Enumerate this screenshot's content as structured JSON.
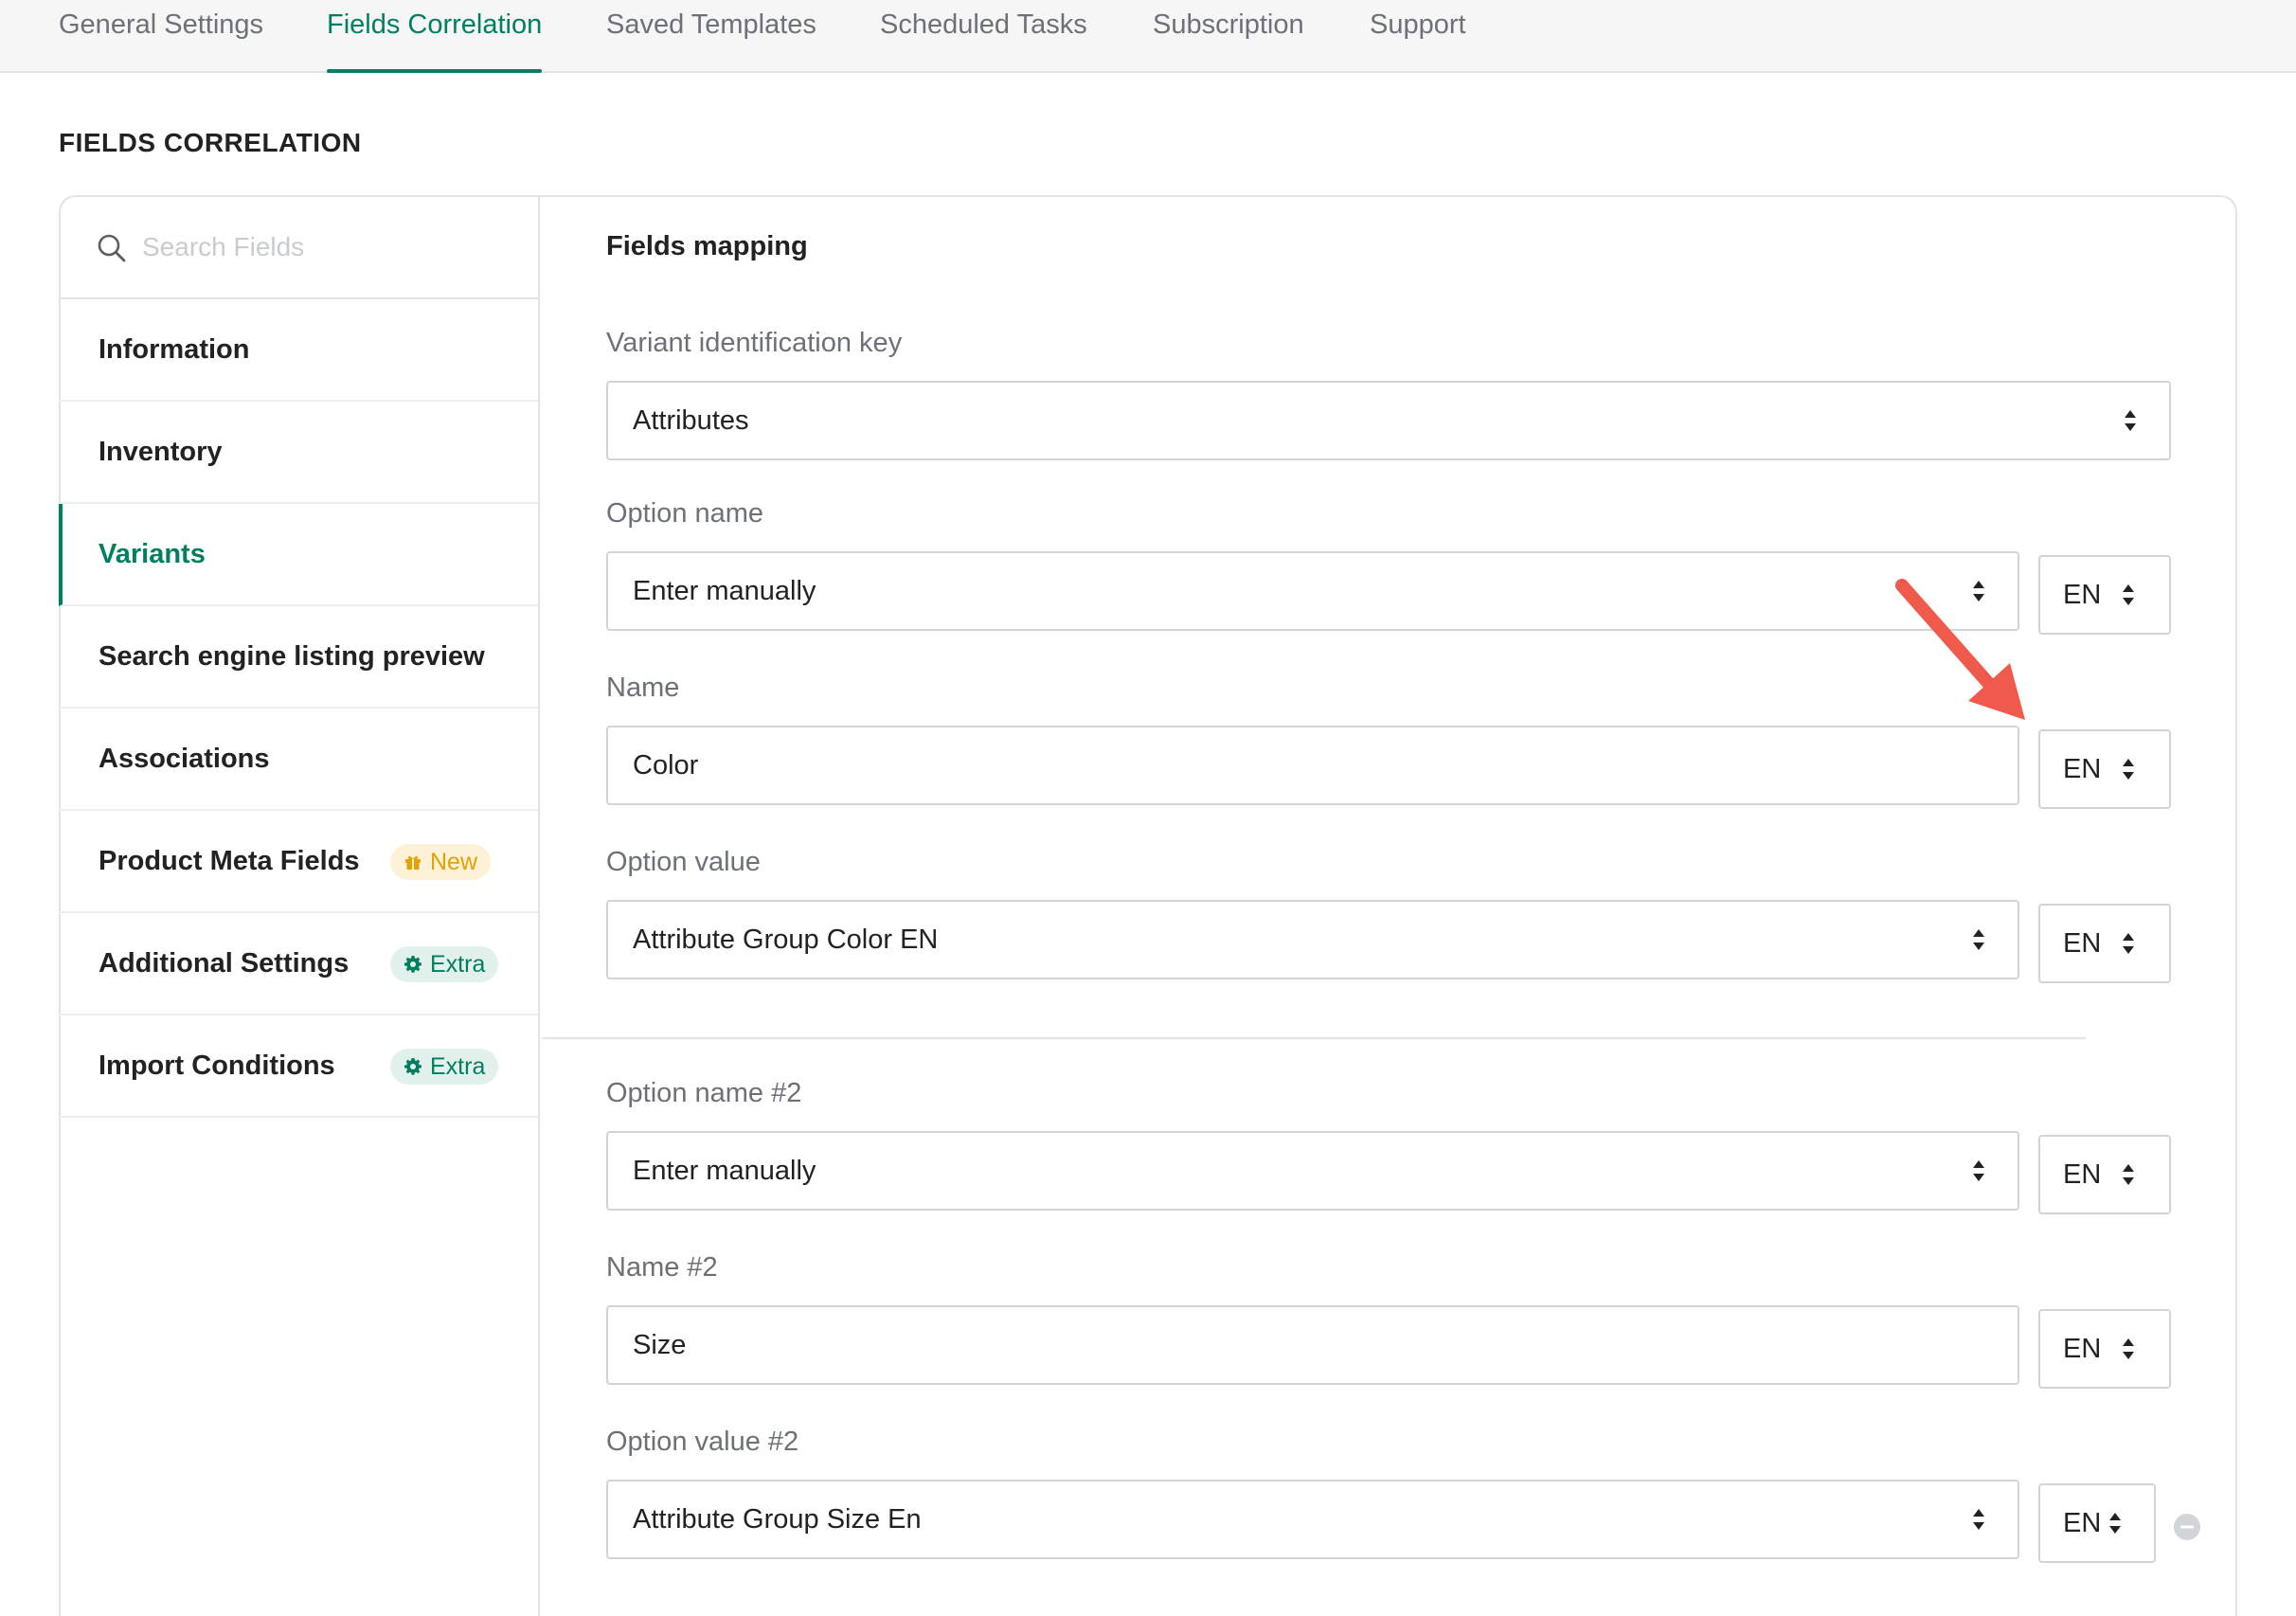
{
  "tabs": [
    {
      "label": "General Settings"
    },
    {
      "label": "Fields Correlation",
      "active": true
    },
    {
      "label": "Saved Templates"
    },
    {
      "label": "Scheduled Tasks"
    },
    {
      "label": "Subscription"
    },
    {
      "label": "Support"
    }
  ],
  "section_title": "FIELDS CORRELATION",
  "search": {
    "placeholder": "Search Fields",
    "value": ""
  },
  "sidebar": {
    "items": [
      {
        "label": "Information"
      },
      {
        "label": "Inventory"
      },
      {
        "label": "Variants",
        "active": true
      },
      {
        "label": "Search engine listing preview"
      },
      {
        "label": "Associations"
      },
      {
        "label": "Product Meta Fields",
        "badge": "New"
      },
      {
        "label": "Additional Settings",
        "badge": "Extra"
      },
      {
        "label": "Import Conditions",
        "badge": "Extra"
      }
    ]
  },
  "main": {
    "title": "Fields mapping",
    "fields": [
      {
        "label": "Variant identification key",
        "value": "Attributes",
        "type": "select"
      },
      {
        "label": "Option name",
        "value": "Enter manually",
        "type": "select",
        "lang": "EN"
      },
      {
        "label": "Name",
        "value": "Color",
        "type": "input",
        "lang": "EN"
      },
      {
        "label": "Option value",
        "value": "Attribute Group Color EN",
        "type": "select",
        "lang": "EN"
      },
      {
        "label": "Option name #2",
        "value": "Enter manually",
        "type": "select",
        "lang": "EN"
      },
      {
        "label": "Name #2",
        "value": "Size",
        "type": "input",
        "lang": "EN"
      },
      {
        "label": "Option value #2",
        "value": "Attribute Group Size En",
        "type": "select",
        "lang": "EN"
      }
    ]
  },
  "colors": {
    "accent": "#008060",
    "annotation_arrow": "#ef5a4c",
    "new_badge": "#e5a100"
  },
  "icons": [
    "search-icon",
    "gift-icon",
    "gear-icon",
    "select-arrows-icon",
    "remove-icon"
  ]
}
